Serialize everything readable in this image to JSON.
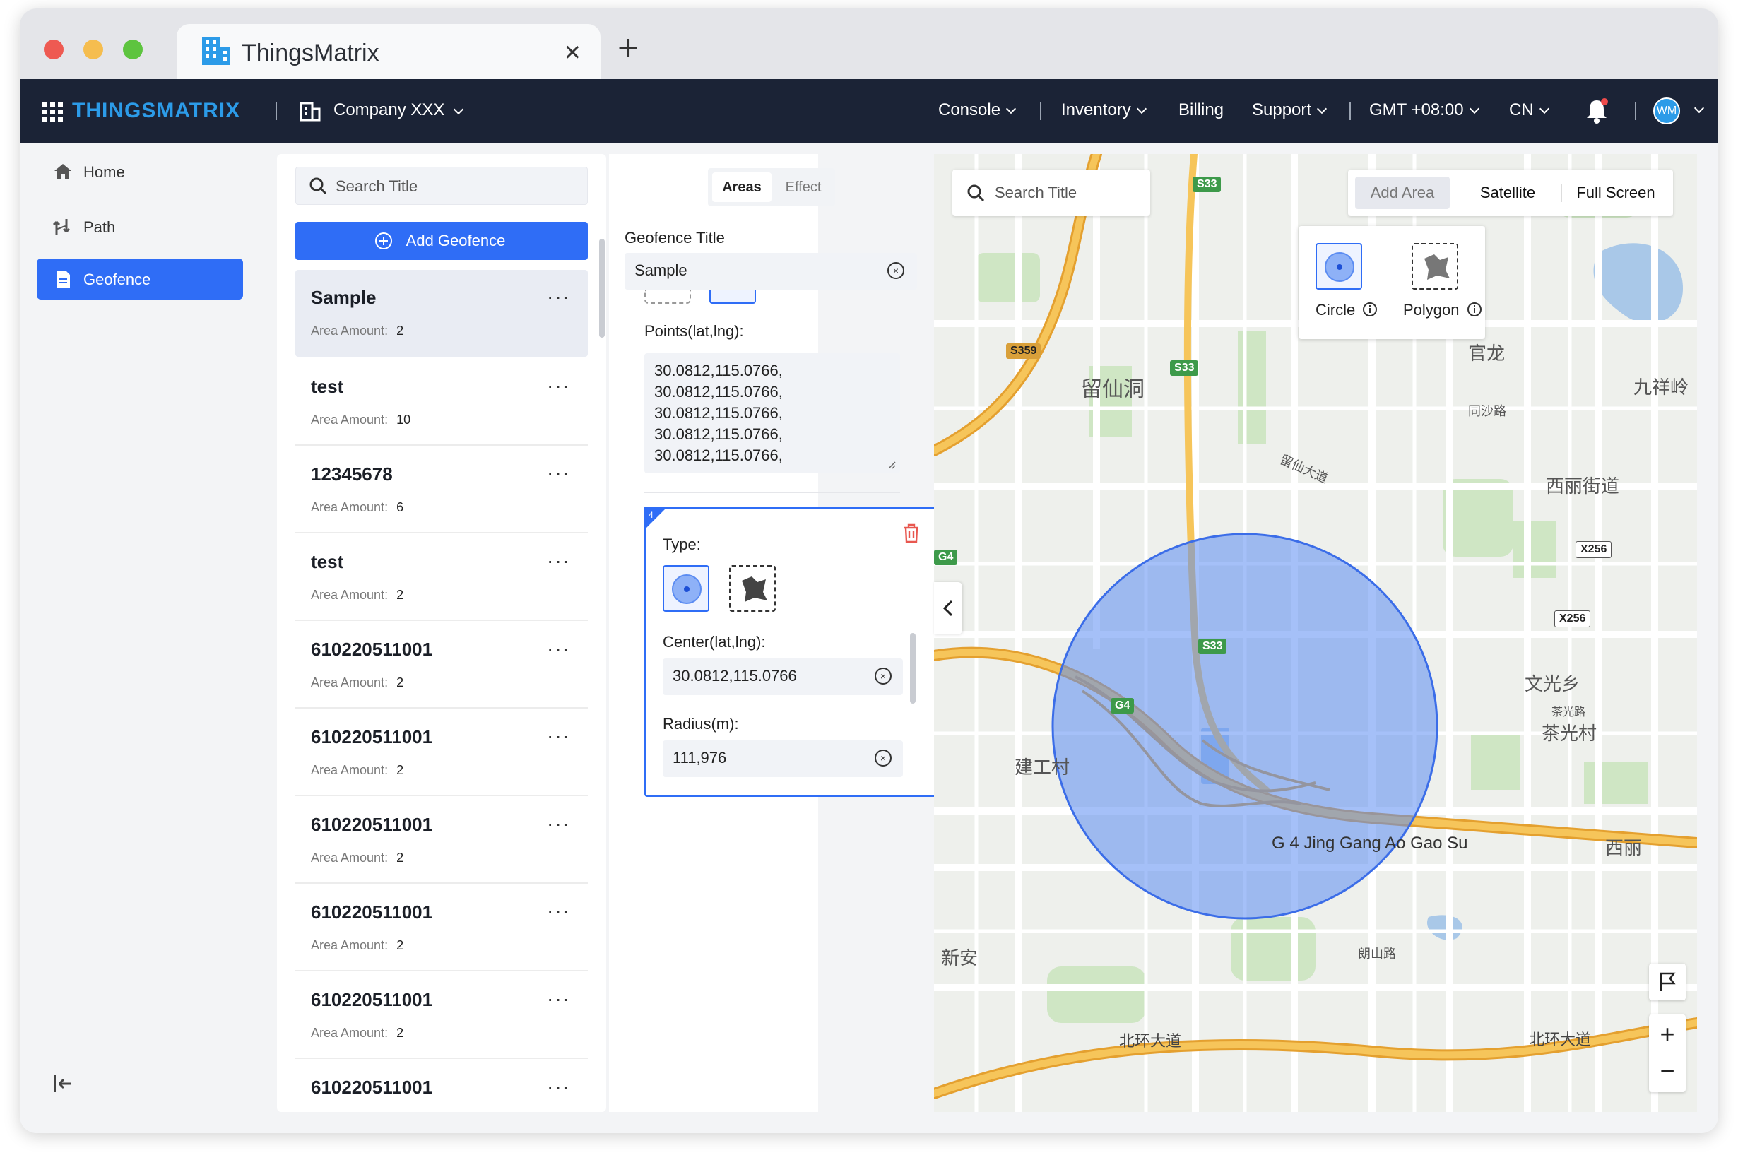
{
  "browser": {
    "tab_title": "ThingsMatrix",
    "close_glyph": "×",
    "new_tab_glyph": "+"
  },
  "topnav": {
    "logo": "THINGSMATRIX",
    "company": "Company XXX",
    "console": "Console",
    "inventory": "Inventory",
    "billing": "Billing",
    "support": "Support",
    "timezone": "GMT +08:00",
    "language": "CN",
    "avatar_initials": "WM"
  },
  "sidebar": {
    "items": [
      {
        "label": "Home"
      },
      {
        "label": "Path"
      },
      {
        "label": "Geofence"
      }
    ]
  },
  "list": {
    "search_placeholder": "Search Title",
    "add_button": "Add Geofence",
    "more_glyph": "···",
    "area_amount_label": "Area Amount:",
    "rows": [
      {
        "title": "Sample",
        "amount": "2"
      },
      {
        "title": "test",
        "amount": "10"
      },
      {
        "title": "12345678",
        "amount": "6"
      },
      {
        "title": "test",
        "amount": "2"
      },
      {
        "title": "610220511001",
        "amount": "2"
      },
      {
        "title": "610220511001",
        "amount": "2"
      },
      {
        "title": "610220511001",
        "amount": "2"
      },
      {
        "title": "610220511001",
        "amount": "2"
      },
      {
        "title": "610220511001",
        "amount": "2"
      },
      {
        "title": "610220511001",
        "amount": ""
      }
    ]
  },
  "editor": {
    "tab_areas": "Areas",
    "tab_effect": "Effect",
    "title_label": "Geofence Title",
    "title_value": "Sample",
    "points_label": "Points(lat,lng):",
    "points": "30.0812,115.0766,\n30.0812,115.0766,\n30.0812,115.0766,\n30.0812,115.0766,\n30.0812,115.0766,",
    "card_index": "4",
    "type_label": "Type:",
    "center_label": "Center(lat,lng):",
    "center_value": "30.0812,115.0766",
    "radius_label": "Radius(m):",
    "radius_value": "111,976"
  },
  "map": {
    "search_placeholder": "Search Title",
    "add_area": "Add Area",
    "satellite": "Satellite",
    "full_screen": "Full Screen",
    "shape_circle": "Circle",
    "shape_polygon": "Polygon",
    "circle_color": "#5b8cf2",
    "labels": {
      "liuxiandong": "留仙洞",
      "guanlong": "官龙",
      "jiuxiangling": "九祥岭",
      "xilijiedao": "西丽街道",
      "wenguangxiang": "文光乡",
      "chaguangcun": "茶光村",
      "jiangongcun": "建工村",
      "xinan": "新安",
      "beihuandadao_l": "北环大道",
      "beihuandadao_r": "北环大道",
      "g4_road": "G 4 Jing Gang Ao Gao Su",
      "xili": "西丽",
      "langshanlu": "朗山路",
      "liuxianavenue": "留仙大道",
      "tongshalu": "同沙路",
      "chaguanglu": "茶光路"
    },
    "road_signs": {
      "s33_top": "S33",
      "s33_mid": "S33",
      "s33_center": "S33",
      "s359": "S359",
      "g4_left": "G4",
      "g4_mid": "G4",
      "x256_a": "X256",
      "x256_b": "X256"
    },
    "zoom_in": "+",
    "zoom_out": "−"
  },
  "colors": {
    "accent": "#2f6df6",
    "nav_bg": "#1b2336",
    "logo": "#2c9be8",
    "highway": "#f2b84b"
  }
}
